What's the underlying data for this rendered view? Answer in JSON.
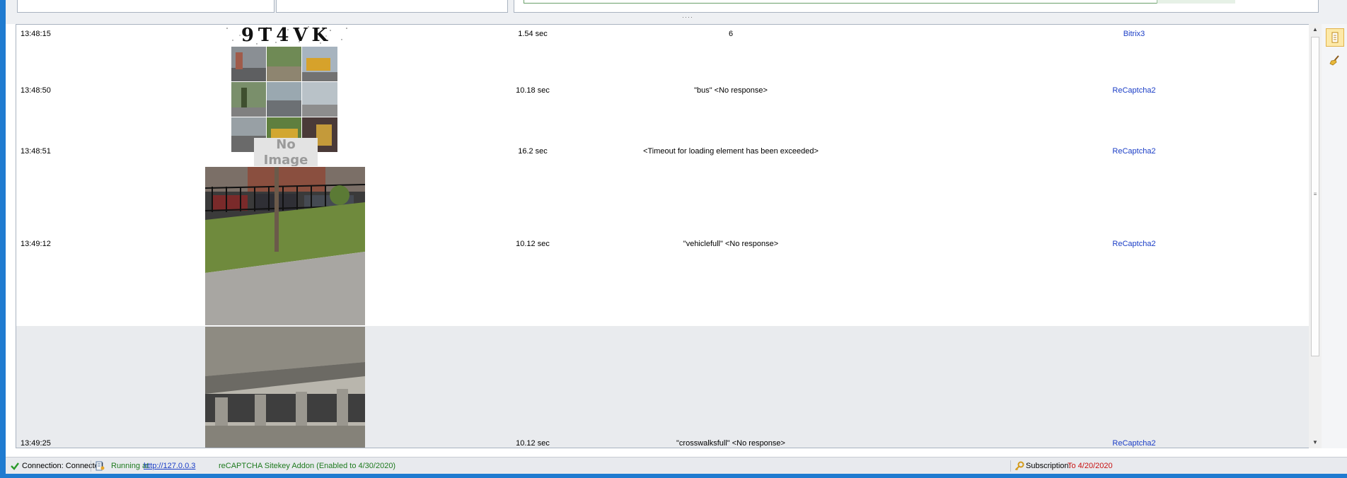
{
  "grid": {
    "rows": [
      {
        "time": "13:48:15",
        "duration": "1.54 sec",
        "answer": "6",
        "type": "Bitrix3",
        "image": "captcha-text"
      },
      {
        "time": "13:48:50",
        "duration": "10.18 sec",
        "answer": "\"bus\" <No response>",
        "type": "ReCaptcha2",
        "image": "recaptcha-grid"
      },
      {
        "time": "13:48:51",
        "duration": "16.2 sec",
        "answer": "<Timeout for loading element has been exceeded>",
        "type": "ReCaptcha2",
        "image": "no-image",
        "no_image_text": "No Image"
      },
      {
        "time": "13:49:12",
        "duration": "10.12 sec",
        "answer": "\"vehiclefull\" <No response>",
        "type": "ReCaptcha2",
        "image": "street-photo"
      },
      {
        "time": "13:49:25",
        "duration": "10.12 sec",
        "answer": "\"crosswalksfull\" <No response>",
        "type": "ReCaptcha2",
        "image": "overpass-photo"
      }
    ],
    "captcha_text": "9T4VK"
  },
  "status": {
    "connection": "Connection: Connected",
    "running_prefix": "Running at",
    "running_url": "http://127.0.0.3",
    "addon": "reCAPTCHA Sitekey Addon (Enabled to 4/30/2020)",
    "subscription_label": "Subscription:",
    "subscription_value": "To 4/20/2020"
  },
  "colors": {
    "frame": "#1f7bd0",
    "link": "#1a3dc6",
    "status_green": "#1d7a1d",
    "status_red": "#c81010",
    "selected_row": "#e9ebee"
  }
}
